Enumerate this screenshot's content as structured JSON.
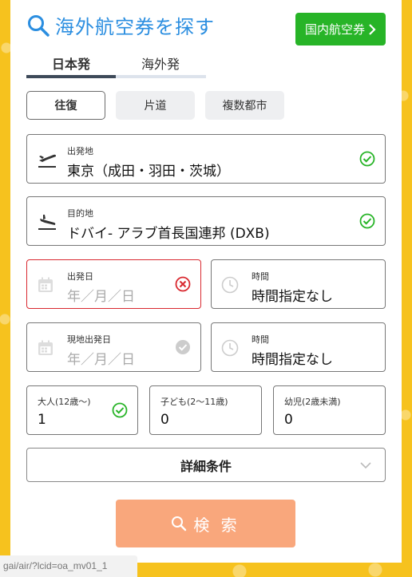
{
  "header": {
    "title": "海外航空券を探す",
    "domestic_button": "国内航空券"
  },
  "tabs": [
    {
      "label": "日本発",
      "active": true
    },
    {
      "label": "海外発",
      "active": false
    }
  ],
  "trip_types": [
    {
      "label": "往復",
      "active": true
    },
    {
      "label": "片道",
      "active": false
    },
    {
      "label": "複数都市",
      "active": false
    }
  ],
  "origin": {
    "label": "出発地",
    "value": "東京（成田・羽田・茨城）",
    "status": "ok"
  },
  "destination": {
    "label": "目的地",
    "value": "ドバイ- アラブ首長国連邦 (DXB)",
    "status": "ok"
  },
  "departure_date": {
    "label": "出発日",
    "placeholder": "年／月／日",
    "status": "error"
  },
  "departure_time": {
    "label": "時間",
    "value": "時間指定なし"
  },
  "local_departure_date": {
    "label": "現地出発日",
    "placeholder": "年／月／日",
    "status": "neutral"
  },
  "local_departure_time": {
    "label": "時間",
    "value": "時間指定なし"
  },
  "passengers": {
    "adult": {
      "label": "大人(12歳～)",
      "value": "1",
      "status": "ok"
    },
    "child": {
      "label": "子ども(2～11歳)",
      "value": "0"
    },
    "infant": {
      "label": "幼児(2歳未満)",
      "value": "0"
    }
  },
  "details_button": "詳細条件",
  "search_button": "検 索",
  "status_url": "gai/air/?lcid=oa_mv01_1",
  "colors": {
    "accent_blue": "#2b8ee0",
    "green": "#27b427",
    "error_red": "#d9282f",
    "search_orange": "#f9a77c",
    "background_yellow": "#f6c21e"
  }
}
